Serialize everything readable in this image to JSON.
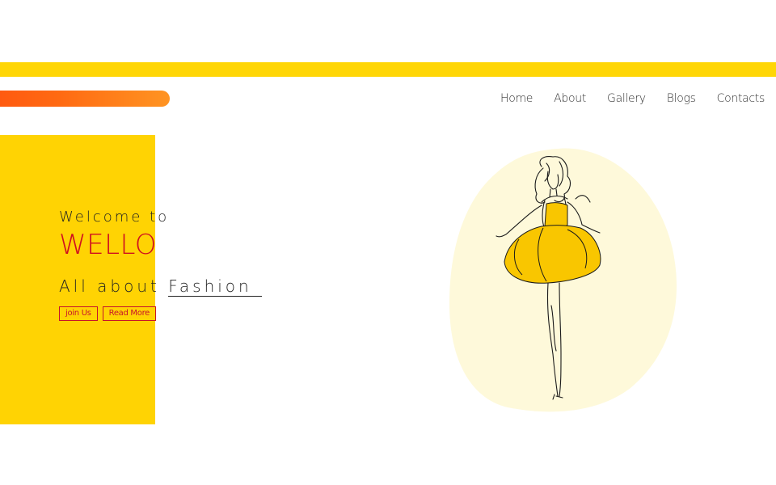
{
  "nav": {
    "items": [
      {
        "label": "Home"
      },
      {
        "label": "About"
      },
      {
        "label": "Gallery"
      },
      {
        "label": "Blogs"
      },
      {
        "label": "Contacts"
      }
    ]
  },
  "hero": {
    "welcome": "Welcome to",
    "brand": "WELLO",
    "tagline_prefix": "All about",
    "tagline_accent": "Fashion",
    "buttons": {
      "join": "join Us",
      "read_more": "Read More"
    }
  },
  "colors": {
    "stripe": "#FFD606",
    "hero_panel": "#FFD303",
    "brand_red": "#D0101F",
    "blob": "#FEF9DA",
    "dress": "#F9C600"
  },
  "icons": {
    "illustration": "fashion-model-sketch"
  }
}
